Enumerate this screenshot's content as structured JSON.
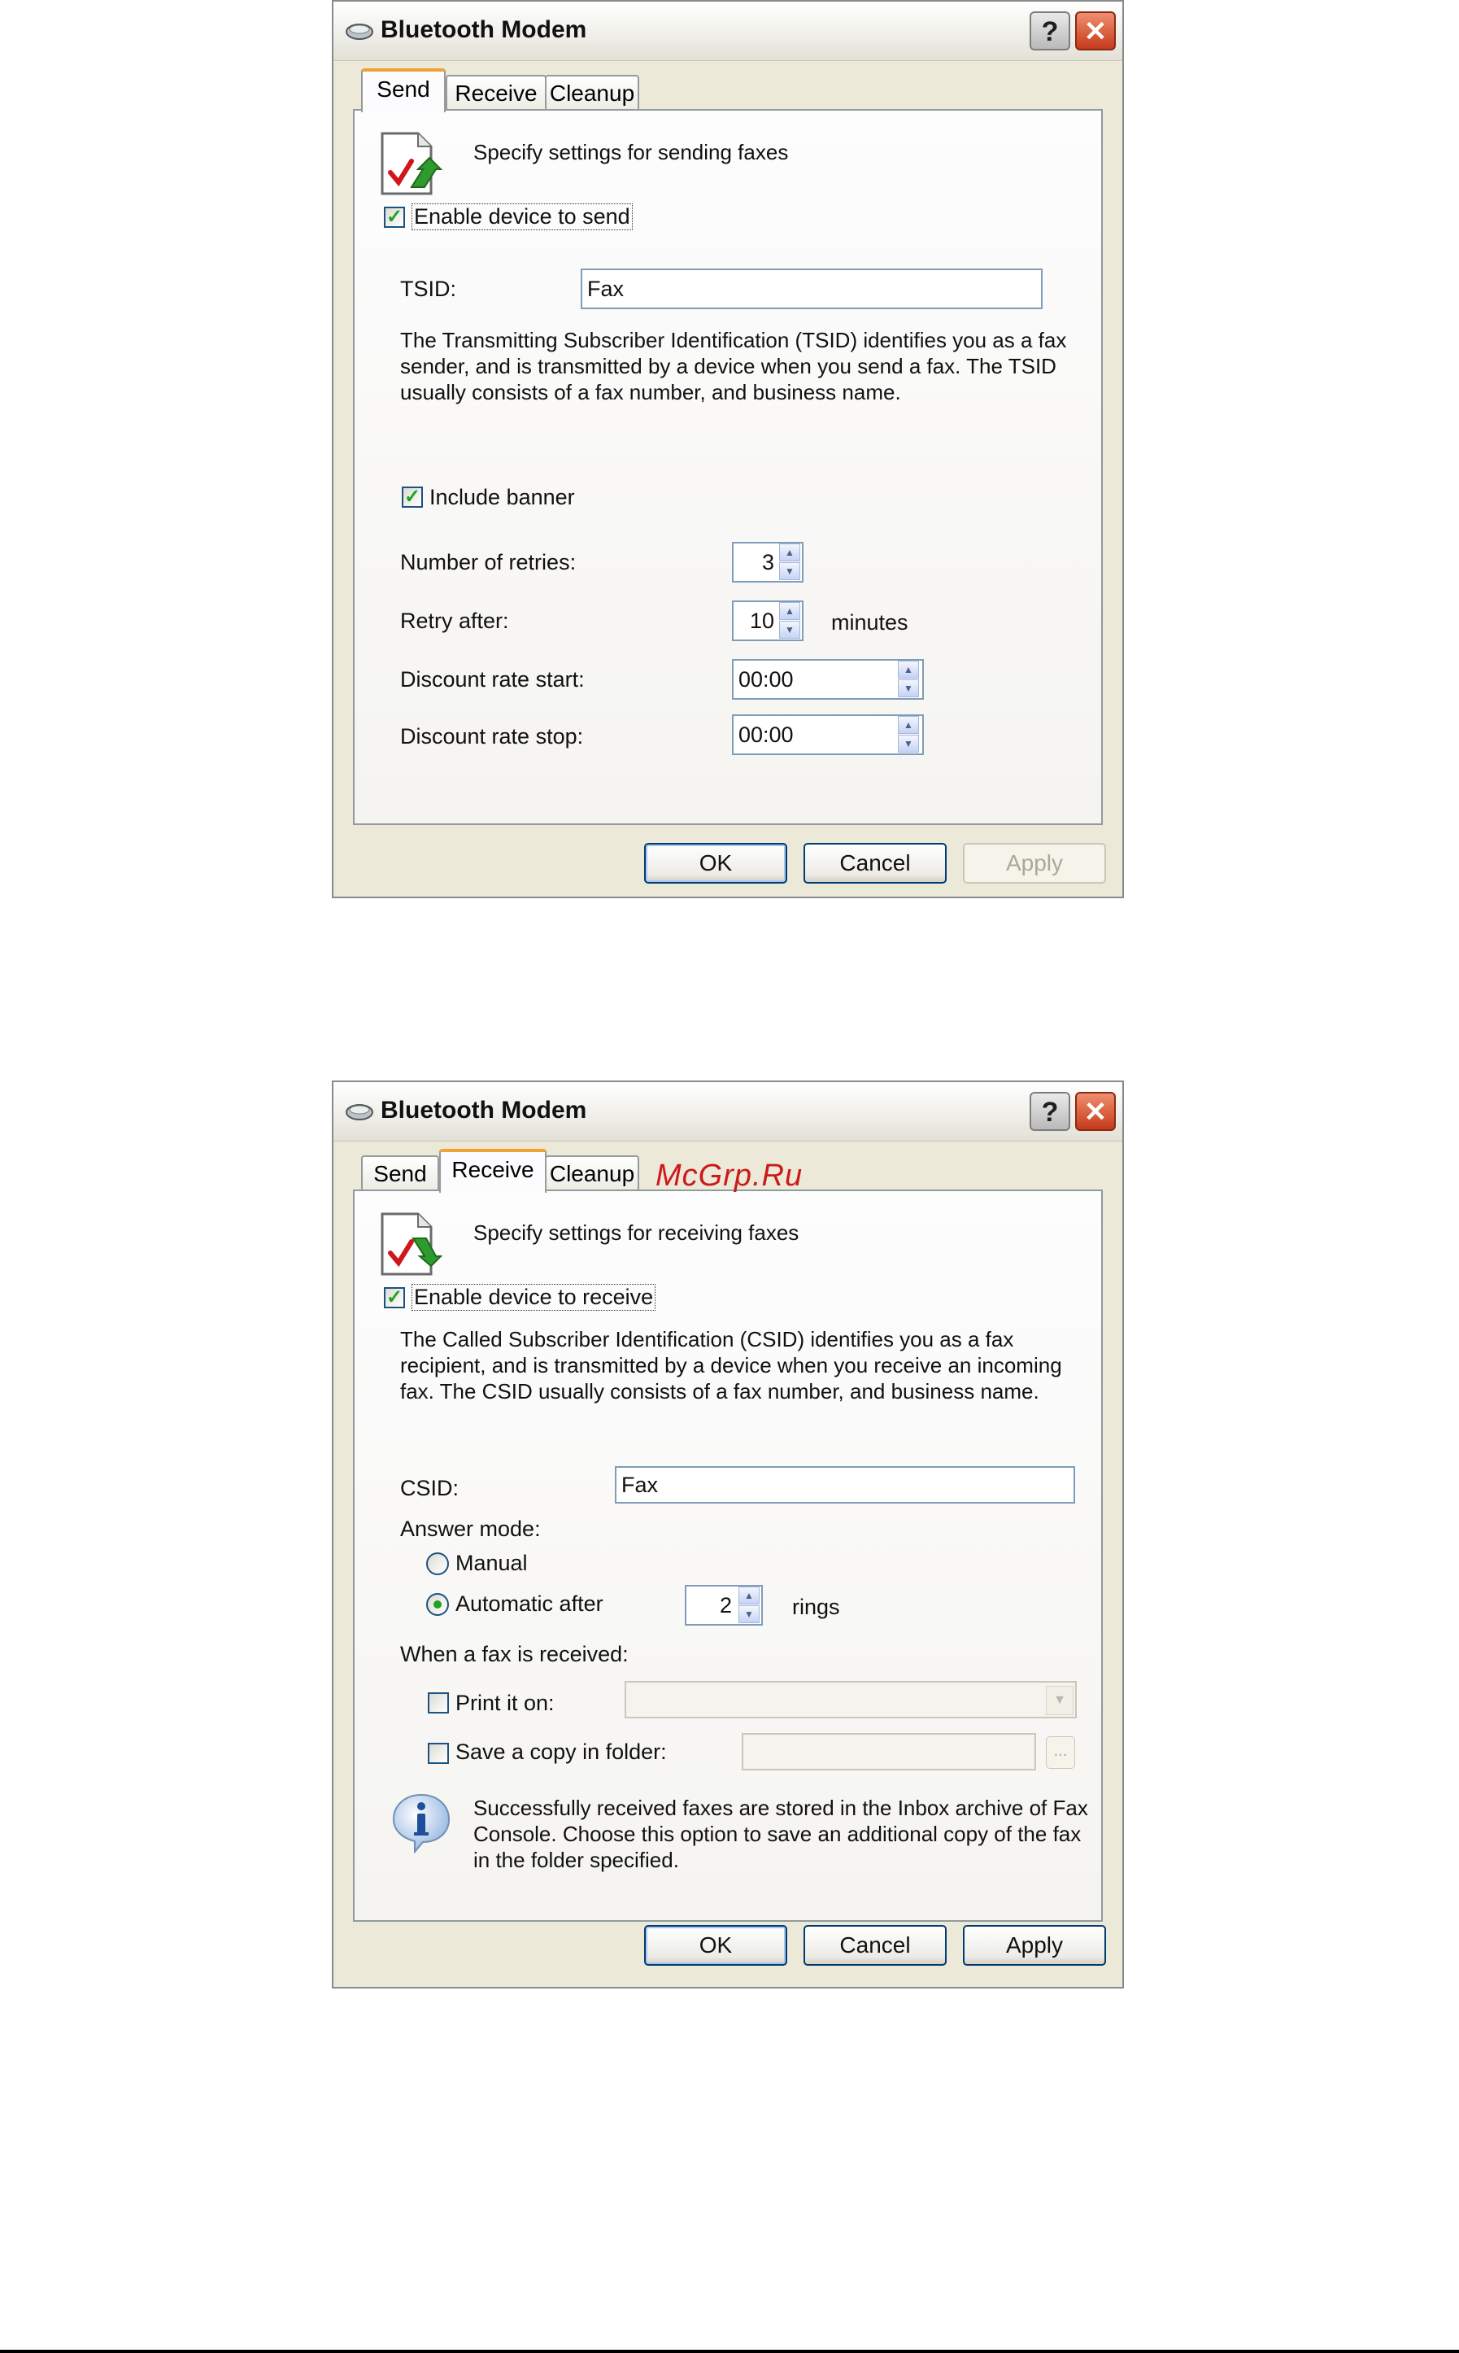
{
  "dialogs": [
    {
      "title": "Bluetooth Modem",
      "tabs": [
        "Send",
        "Receive",
        "Cleanup"
      ],
      "active_tab": "Send",
      "header": "Specify settings for sending faxes",
      "enable_checkbox": {
        "label": "Enable device to send",
        "checked": true
      },
      "tsid": {
        "label": "TSID:",
        "value": "Fax"
      },
      "tsid_description": "The Transmitting Subscriber Identification (TSID) identifies you as a fax sender, and is transmitted by a device when you send a fax. The TSID usually consists of a fax number, and business name.",
      "include_banner": {
        "label": "Include banner",
        "checked": true
      },
      "retries": {
        "label": "Number of retries:",
        "value": "3"
      },
      "retry_after": {
        "label": "Retry after:",
        "value": "10",
        "unit": "minutes"
      },
      "discount_start": {
        "label": "Discount rate start:",
        "value": "00:00"
      },
      "discount_stop": {
        "label": "Discount rate stop:",
        "value": "00:00"
      },
      "buttons": {
        "ok": "OK",
        "cancel": "Cancel",
        "apply": "Apply"
      }
    },
    {
      "title": "Bluetooth Modem",
      "tabs": [
        "Send",
        "Receive",
        "Cleanup"
      ],
      "active_tab": "Receive",
      "header": "Specify settings for receiving faxes",
      "enable_checkbox": {
        "label": "Enable device to receive",
        "checked": true
      },
      "csid_description": "The Called Subscriber Identification (CSID) identifies you as a fax recipient, and is transmitted by a device when you receive an incoming fax. The CSID usually consists of a fax number, and business name.",
      "csid": {
        "label": "CSID:",
        "value": "Fax"
      },
      "answer_mode": {
        "label": "Answer mode:",
        "manual": "Manual",
        "automatic": "Automatic after",
        "selected": "automatic",
        "rings_value": "2",
        "rings_unit": "rings"
      },
      "when_received": "When a fax is received:",
      "print_it_on": {
        "label": "Print it on:",
        "checked": false,
        "value": ""
      },
      "save_copy": {
        "label": "Save a copy in folder:",
        "checked": false,
        "value": "",
        "browse": "..."
      },
      "info_text": "Successfully received faxes are stored in the Inbox archive of Fax Console. Choose this option to save an additional copy of the fax in the folder specified.",
      "buttons": {
        "ok": "OK",
        "cancel": "Cancel",
        "apply": "Apply"
      }
    }
  ],
  "watermark": "McGrp.Ru",
  "icons": {
    "fax": "fax-page-icon",
    "info": "info-icon",
    "title": "modem-icon"
  }
}
